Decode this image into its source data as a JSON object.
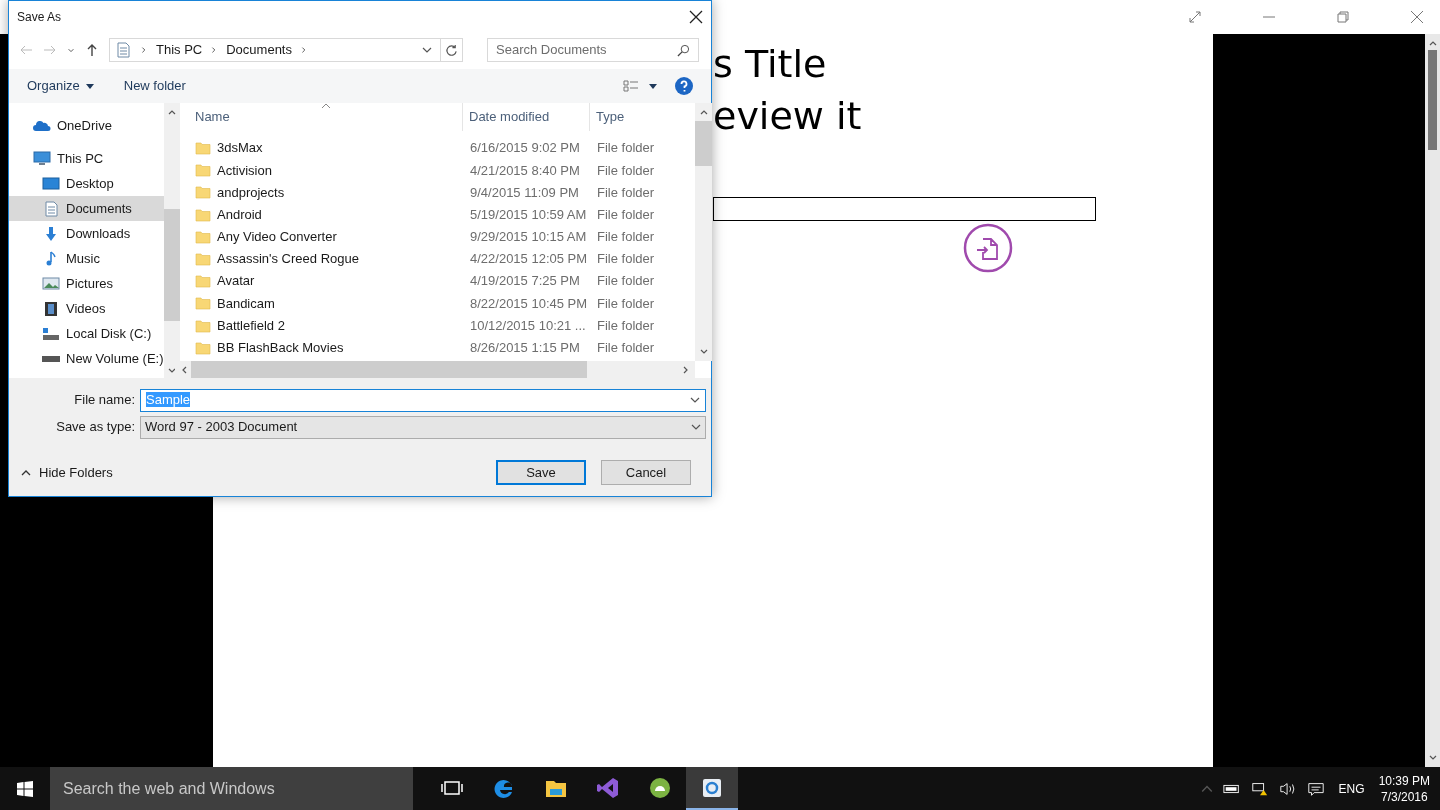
{
  "app": {
    "heading_lines": [
      "s Title",
      "eview it"
    ]
  },
  "dialog": {
    "title": "Save As",
    "breadcrumb": [
      "This PC",
      "Documents"
    ],
    "search": {
      "placeholder": "Search Documents"
    },
    "toolbar": [
      "Organize",
      "New folder"
    ],
    "nav": [
      {
        "label": "OneDrive",
        "selected": false
      },
      {
        "label": "This PC",
        "selected": false,
        "children": [
          {
            "label": "Desktop",
            "selected": false
          },
          {
            "label": "Documents",
            "selected": true
          },
          {
            "label": "Downloads",
            "selected": false
          },
          {
            "label": "Music",
            "selected": false
          },
          {
            "label": "Pictures",
            "selected": false
          },
          {
            "label": "Videos",
            "selected": false
          },
          {
            "label": "Local Disk (C:)",
            "selected": false
          },
          {
            "label": "New Volume (E:)",
            "selected": false
          }
        ]
      }
    ],
    "columns": [
      "Name",
      "Date modified",
      "Type"
    ],
    "rows": [
      {
        "name": "3dsMax",
        "date": "6/16/2015 9:02 PM",
        "type": "File folder"
      },
      {
        "name": "Activision",
        "date": "4/21/2015 8:40 PM",
        "type": "File folder"
      },
      {
        "name": "andprojects",
        "date": "9/4/2015 11:09 PM",
        "type": "File folder"
      },
      {
        "name": "Android",
        "date": "5/19/2015 10:59 AM",
        "type": "File folder"
      },
      {
        "name": "Any Video Converter",
        "date": "9/29/2015 10:15 AM",
        "type": "File folder"
      },
      {
        "name": "Assassin's Creed Rogue",
        "date": "4/22/2015 12:05 PM",
        "type": "File folder"
      },
      {
        "name": "Avatar",
        "date": "4/19/2015 7:25 PM",
        "type": "File folder"
      },
      {
        "name": "Bandicam",
        "date": "8/22/2015 10:45 PM",
        "type": "File folder"
      },
      {
        "name": "Battlefield 2",
        "date": "10/12/2015 10:21 ...",
        "type": "File folder"
      },
      {
        "name": "BB FlashBack Movies",
        "date": "8/26/2015 1:15 PM",
        "type": "File folder"
      }
    ],
    "file_name": {
      "label": "File name:",
      "value": "Sample"
    },
    "save_type": {
      "label": "Save as type:",
      "value": "Word 97 - 2003 Document"
    },
    "hide_folders": "Hide Folders",
    "buttons": [
      "Save",
      "Cancel"
    ]
  },
  "taskbar": {
    "search": {
      "placeholder": "Search the web and Windows"
    },
    "apps": [
      {
        "selected": false
      },
      {
        "selected": false
      },
      {
        "selected": false
      },
      {
        "selected": false
      },
      {
        "selected": false
      },
      {
        "selected": true
      }
    ],
    "language": "ENG",
    "time": "10:39 PM",
    "date": "7/3/2016"
  }
}
